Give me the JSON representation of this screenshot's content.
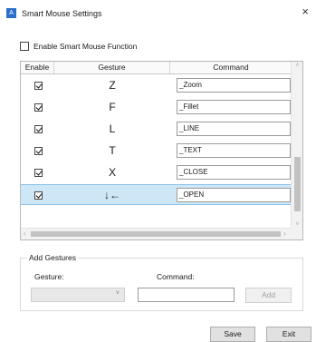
{
  "window": {
    "title": "Smart Mouse Settings",
    "app_icon": "A",
    "close_glyph": "×"
  },
  "enable_function": {
    "label": "Enable Smart Mouse Function",
    "checked": false
  },
  "table": {
    "headers": {
      "enable": "Enable",
      "gesture": "Gesture",
      "command": "Command"
    },
    "rows": [
      {
        "enabled": true,
        "gesture": "Z",
        "command": "_Zoom",
        "selected": false
      },
      {
        "enabled": true,
        "gesture": "F",
        "command": "_Fillet",
        "selected": false
      },
      {
        "enabled": true,
        "gesture": "L",
        "command": "_LINE",
        "selected": false
      },
      {
        "enabled": true,
        "gesture": "T",
        "command": "_TEXT",
        "selected": false
      },
      {
        "enabled": true,
        "gesture": "X",
        "command": "_CLOSE",
        "selected": false
      },
      {
        "enabled": true,
        "gesture": "↓←",
        "command": "_OPEN",
        "selected": true
      }
    ],
    "scroll": {
      "up": "˄",
      "down": "˅",
      "left": "‹",
      "right": "›"
    }
  },
  "add_gestures": {
    "title": "Add Gestures",
    "gesture_label": "Gesture:",
    "command_label": "Command:",
    "gesture_value": "",
    "command_value": "",
    "add_button": "Add",
    "caret": "˅"
  },
  "footer": {
    "save_button": "Save",
    "exit_button": "Exit"
  },
  "colors": {
    "selected_row": "#cde7f7",
    "app_icon": "#2c6ecb"
  }
}
